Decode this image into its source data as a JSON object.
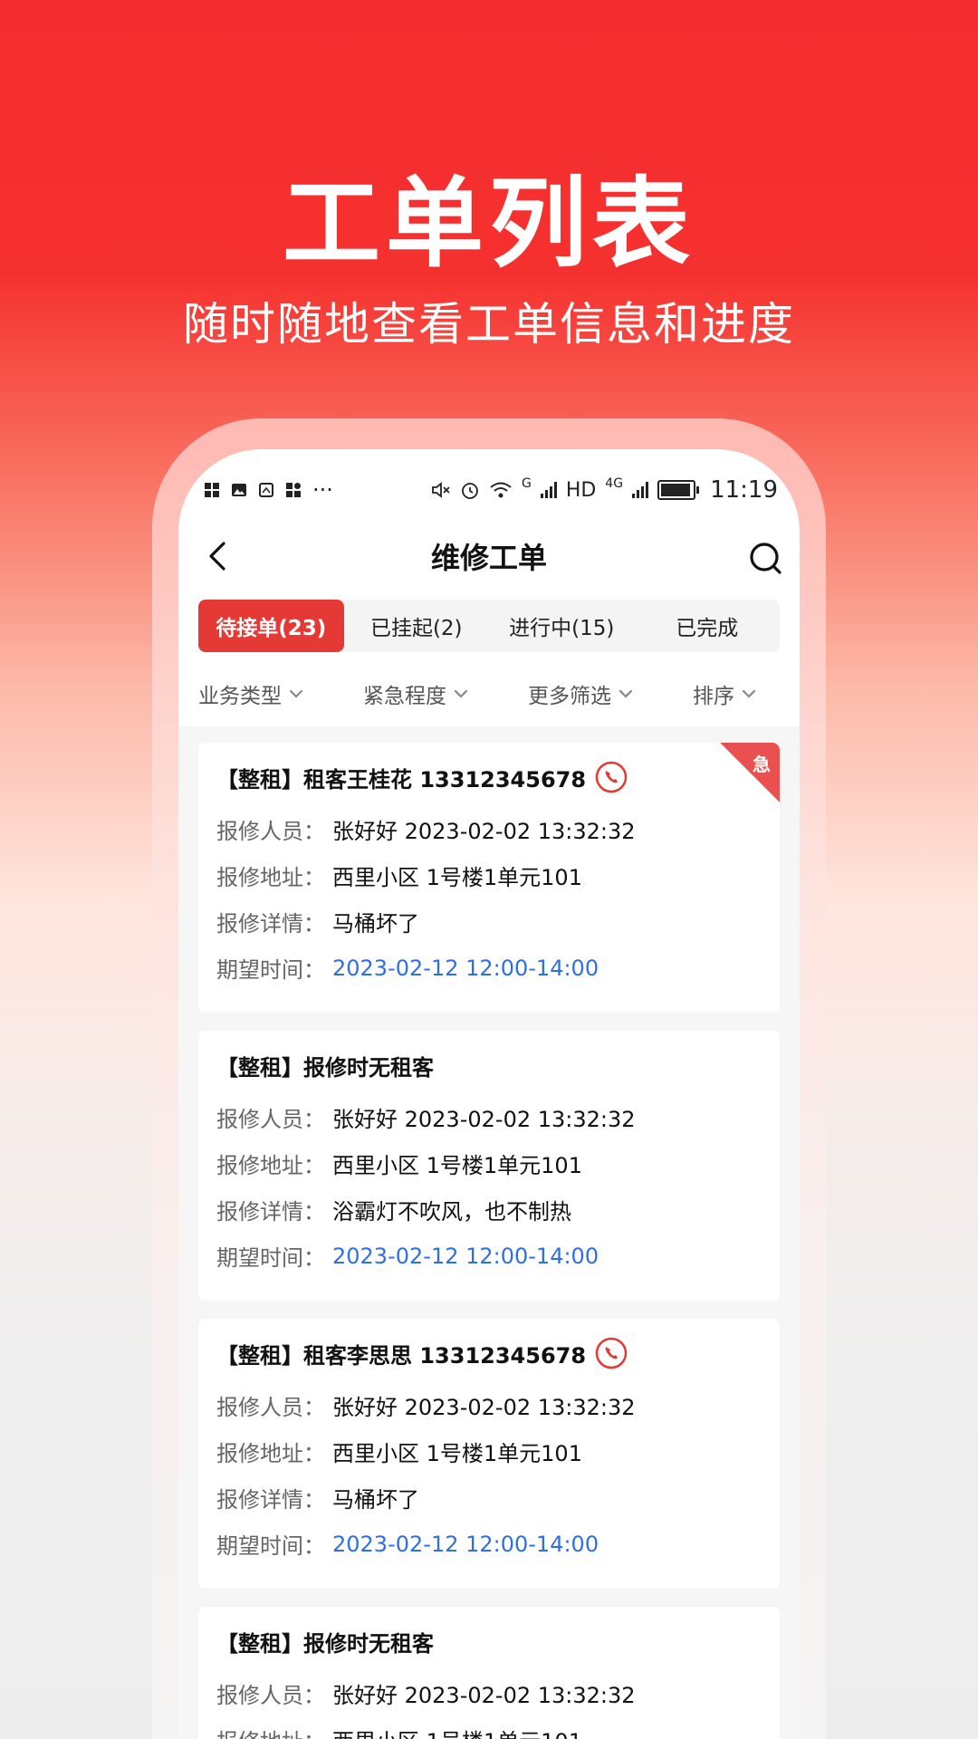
{
  "hero": {
    "title": "工单列表",
    "subtitle": "随时随地查看工单信息和进度"
  },
  "statusbar": {
    "time": "11:19",
    "hd": "HD",
    "network_g": "G",
    "network_4g": "4G",
    "more": "···"
  },
  "navbar": {
    "title": "维修工单"
  },
  "tabs": [
    {
      "label": "待接单(23)"
    },
    {
      "label": "已挂起(2)"
    },
    {
      "label": "进行中(15)"
    },
    {
      "label": "已完成"
    }
  ],
  "filters": [
    {
      "label": "业务类型"
    },
    {
      "label": "紧急程度"
    },
    {
      "label": "更多筛选"
    },
    {
      "label": "排序"
    }
  ],
  "labels": {
    "reporter": "报修人员：",
    "address": "报修地址：",
    "detail": "报修详情：",
    "expected": "期望时间：",
    "urgent": "急"
  },
  "orders": [
    {
      "title": "【整租】租客王桂花 13312345678",
      "has_phone": true,
      "urgent": true,
      "reporter": "张好好 2023-02-02 13:32:32",
      "address": "西里小区 1号楼1单元101",
      "detail": "马桶坏了",
      "expected": "2023-02-12 12:00-14:00"
    },
    {
      "title": "【整租】报修时无租客",
      "has_phone": false,
      "urgent": false,
      "reporter": "张好好 2023-02-02 13:32:32",
      "address": "西里小区 1号楼1单元101",
      "detail": "浴霸灯不吹风，也不制热",
      "expected": "2023-02-12 12:00-14:00"
    },
    {
      "title": "【整租】租客李思思 13312345678",
      "has_phone": true,
      "urgent": false,
      "reporter": "张好好 2023-02-02 13:32:32",
      "address": "西里小区 1号楼1单元101",
      "detail": "马桶坏了",
      "expected": "2023-02-12 12:00-14:00"
    },
    {
      "title": "【整租】报修时无租客",
      "has_phone": false,
      "urgent": false,
      "reporter": "张好好 2023-02-02 13:32:32",
      "address": "西里小区 1号楼1单元101"
    }
  ],
  "colors": {
    "brand": "#f5312f",
    "active_tab": "#e53935",
    "link_blue": "#2f6fe0"
  }
}
